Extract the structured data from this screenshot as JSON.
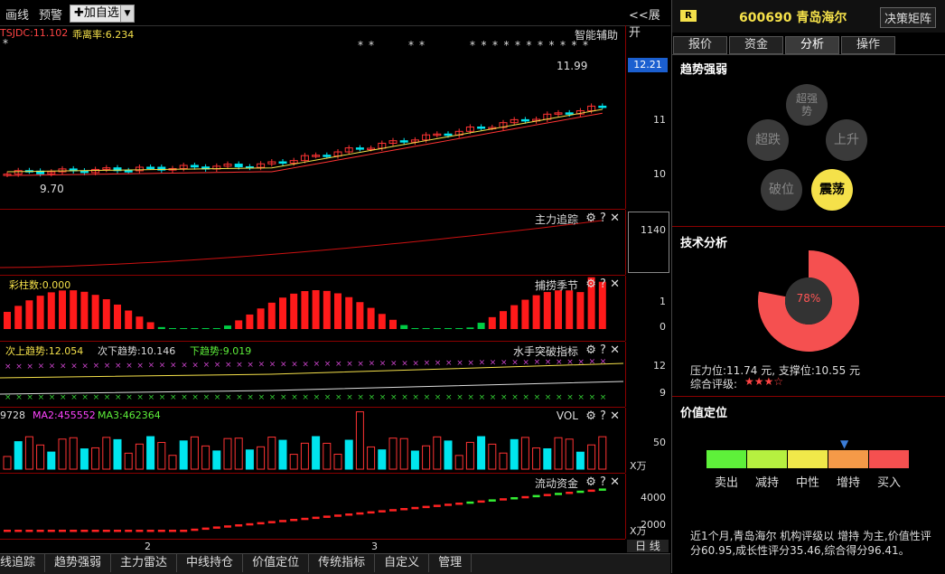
{
  "toolbar": {
    "draw": "画线",
    "alert": "预警",
    "add": "加自选",
    "expand": "展开"
  },
  "main": {
    "label_left": "TSJDC:11.102",
    "label_div": "乖离率:6.234",
    "assist": "智能辅助",
    "price_high": "11.99",
    "price_low": "9.70",
    "current_price": "12.21",
    "y_labels": [
      "11",
      "10"
    ]
  },
  "panels": {
    "main_force": {
      "title": "主力追踪",
      "value": "1140"
    },
    "season": {
      "title": "捕捞季节",
      "color_col": "彩柱数:0.000",
      "y": [
        "1",
        "0"
      ]
    },
    "sailor": {
      "title": "水手突破指标",
      "upper": "次上趋势:12.054",
      "lower": "次下趋势:10.146",
      "down": "下趋势:9.019",
      "y": [
        "12",
        "9"
      ]
    },
    "vol": {
      "title": "VOL",
      "ma1": "9728",
      "ma2": "MA2:455552",
      "ma3": "MA3:462364",
      "y": "50",
      "unit": "X万"
    },
    "flow": {
      "title": "流动资金",
      "y": [
        "4000",
        "2000"
      ],
      "unit": "X万"
    }
  },
  "x_labels": [
    "2",
    "3"
  ],
  "day_line": "日 线",
  "bottom_tabs": [
    "线追踪",
    "趋势强弱",
    "主力雷达",
    "中线持仓",
    "价值定位",
    "传统指标",
    "自定义",
    "管理"
  ],
  "right": {
    "badge": "R",
    "stock": "600690 青岛海尔",
    "decision_btn": "决策矩阵",
    "tabs": [
      "报价",
      "资金",
      "分析",
      "操作"
    ],
    "active_tab": "分析",
    "trend_title": "趋势强弱",
    "trend": {
      "super_strong": "超强势",
      "oversold": "超跌",
      "up": "上升",
      "break": "破位",
      "swing": "震荡"
    },
    "tech_title": "技术分析",
    "donut_pct": "78%",
    "donut_fraction": 0.78,
    "resistance": "压力位:11.74 元, 支撑位:10.55 元",
    "rating_label": "综合评级:",
    "stars": "★★★☆",
    "value_title": "价值定位",
    "value_labels": [
      "卖出",
      "减持",
      "中性",
      "增持",
      "买入"
    ],
    "value_colors": [
      "#5ef03a",
      "#b6f040",
      "#f0e84a",
      "#f59a48",
      "#f55050"
    ],
    "value_selected_index": 3,
    "commentary": "近1个月,青岛海尔 机构评级以 增持 为主,价值性评分60.95,成长性评分35.46,综合得分96.41。"
  },
  "colors": {
    "up": "#ff3333",
    "down": "#00e5ee",
    "accent": "#f5e14a",
    "border": "#8b0000"
  }
}
